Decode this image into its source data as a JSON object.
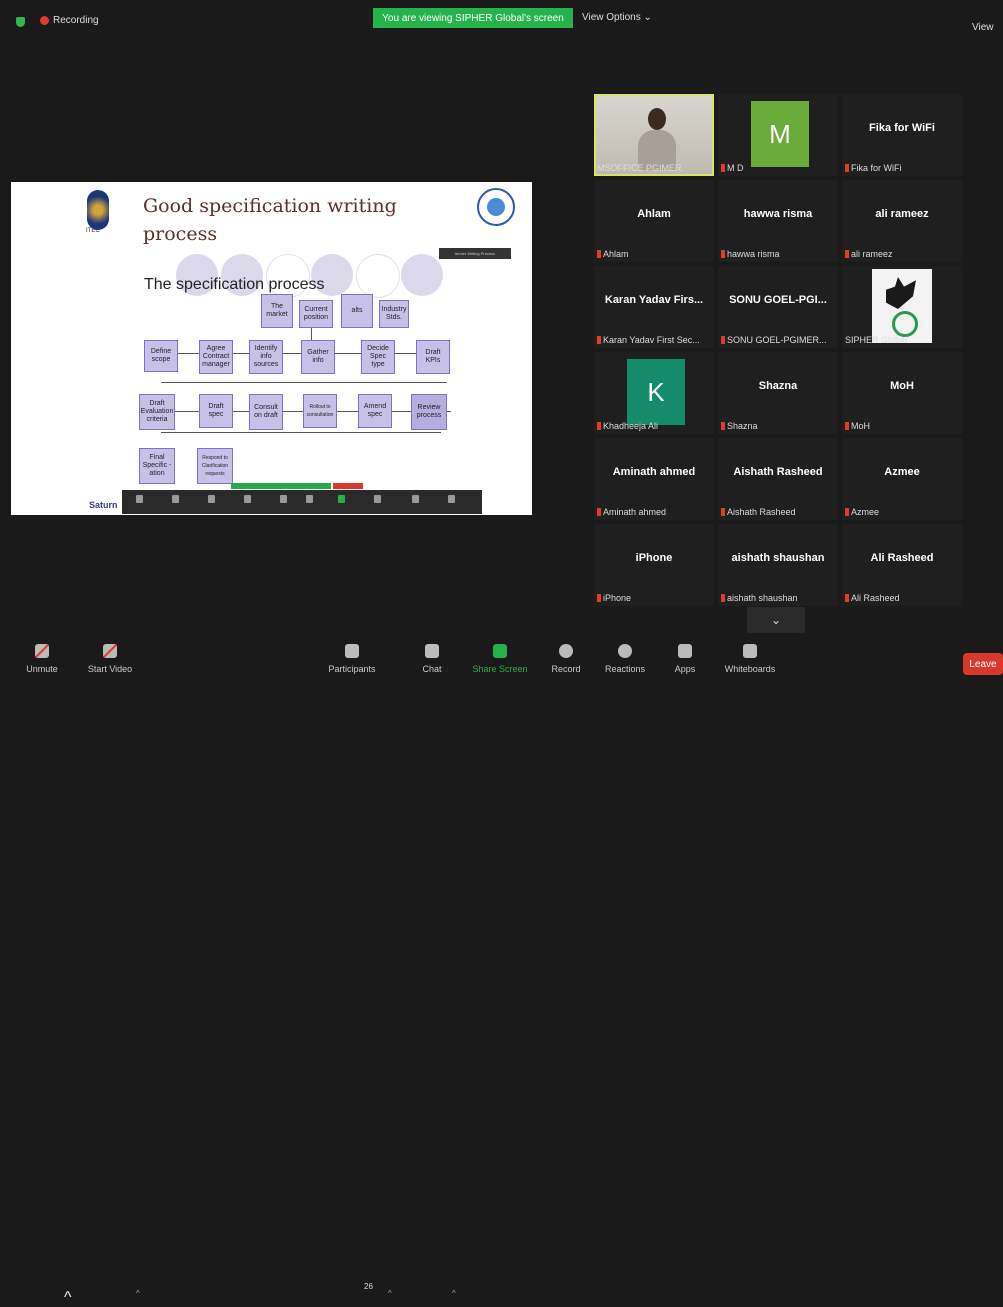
{
  "topbar": {
    "recording_label": "Recording",
    "viewing_banner": "You are viewing SIPHER Global's screen",
    "view_options": "View Options ⌄",
    "view_label": "View"
  },
  "slide": {
    "title_line1": "Good specification writing",
    "title_line2": "process",
    "logo_left_text": "ITEC",
    "tag_box": "tender Writing Process",
    "subtitle": "The specification process",
    "bottom_logo": "Saturn",
    "boxes": {
      "the_market": "The market",
      "current_position": "Current position",
      "alts": "alts",
      "industry_stds": "Industry Stds.",
      "define_scope": "Define scope",
      "agree_contract": "Agree Contract manager",
      "identify_info": "Identify info sources",
      "gather_info": "Gather info",
      "decide_spec": "Decide Spec type",
      "draft_kpis": "Draft KPIs",
      "draft_eval": "Draft Evaluation criteria",
      "draft_spec": "Draft spec",
      "consult_draft": "Consult on draft",
      "rollout": "Rollout to consultation",
      "amend_spec": "Amend spec",
      "review_process": "Review process",
      "final_spec": "Final Specific -ation",
      "respond": "Respond to Clarification requests"
    }
  },
  "gallery": {
    "tiles": [
      {
        "name": "",
        "label": "MSOFFICE PGIMER",
        "type": "video"
      },
      {
        "name": "",
        "label": "M D",
        "type": "avatar",
        "initial": "M"
      },
      {
        "name": "Fika for WiFi",
        "label": "Fika for WiFi",
        "type": "name"
      },
      {
        "name": "Ahlam",
        "label": "Ahlam",
        "type": "name"
      },
      {
        "name": "hawwa risma",
        "label": "hawwa risma",
        "type": "name"
      },
      {
        "name": "ali rameez",
        "label": "ali rameez",
        "type": "name"
      },
      {
        "name": "Karan Yadav Firs...",
        "label": "Karan Yadav First Sec...",
        "type": "name"
      },
      {
        "name": "SONU GOEL-PGI...",
        "label": "SONU GOEL-PGIMER...",
        "type": "name"
      },
      {
        "name": "",
        "label": "SIPHER Global",
        "type": "logo"
      },
      {
        "name": "",
        "label": "Khadheeja Ali",
        "type": "avatar",
        "initial": "K"
      },
      {
        "name": "Shazna",
        "label": "Shazna",
        "type": "name"
      },
      {
        "name": "MoH",
        "label": "MoH",
        "type": "name"
      },
      {
        "name": "Aminath ahmed",
        "label": "Aminath ahmed",
        "type": "name"
      },
      {
        "name": "Aishath Rasheed",
        "label": "Aishath Rasheed",
        "type": "name"
      },
      {
        "name": "Azmee",
        "label": "Azmee",
        "type": "name"
      },
      {
        "name": "iPhone",
        "label": "iPhone",
        "type": "name"
      },
      {
        "name": "aishath shaushan",
        "label": "aishath shaushan",
        "type": "name"
      },
      {
        "name": "Ali Rasheed",
        "label": "Ali Rasheed",
        "type": "name"
      }
    ],
    "collapse_label": "⌄"
  },
  "toolbar": {
    "unmute": "Unmute",
    "start_video": "Start Video",
    "participants": "Participants",
    "participant_count": "26",
    "chat": "Chat",
    "share_screen": "Share Screen",
    "record": "Record",
    "reactions": "Reactions",
    "apps": "Apps",
    "whiteboards": "Whiteboards",
    "leave": "Leave"
  },
  "colors": {
    "banner_green": "#26b34b",
    "leave_red": "#d9382f",
    "active_speaker": "#d9e26a"
  }
}
